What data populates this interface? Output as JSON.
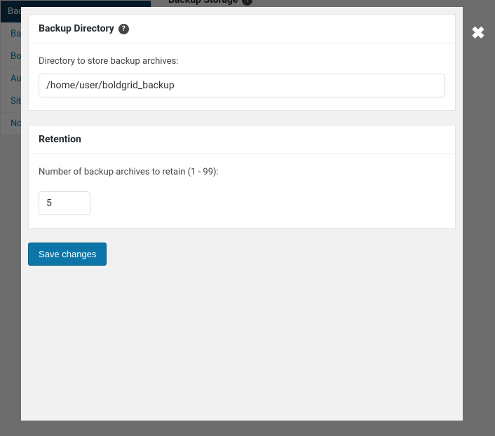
{
  "bg_header": "Backup Storage",
  "sidebar": {
    "active": "Backup Storage",
    "items": [
      {
        "label": "Ba"
      },
      {
        "label": "Bo"
      },
      {
        "label": "Au"
      },
      {
        "label": "Sit"
      },
      {
        "label": "No"
      }
    ]
  },
  "modal": {
    "backup_dir": {
      "title": "Backup Directory",
      "label": "Directory to store backup archives:",
      "value": "/home/user/boldgrid_backup"
    },
    "retention": {
      "title": "Retention",
      "label": "Number of backup archives to retain (1 - 99):",
      "value": "5"
    },
    "save_button": "Save changes",
    "help_glyph": "?",
    "close_glyph": "✖"
  }
}
